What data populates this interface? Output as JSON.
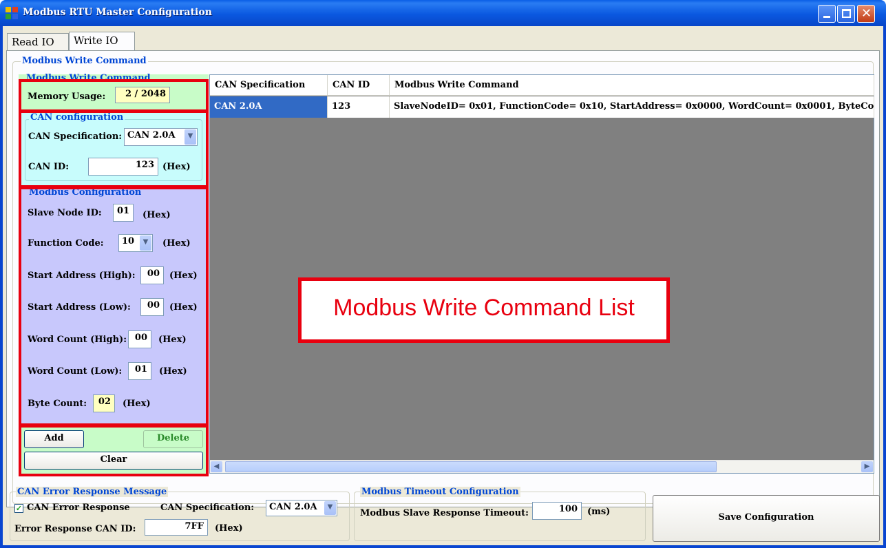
{
  "window": {
    "title": "Modbus RTU Master Configuration"
  },
  "tabs": [
    {
      "label": "Read IO"
    },
    {
      "label": "Write IO"
    }
  ],
  "write_group": {
    "title": "Modbus Write Command"
  },
  "inner_group": {
    "title": "Modbus Write Command"
  },
  "memory": {
    "label": "Memory Usage:",
    "value": "2 / 2048"
  },
  "can_config": {
    "title": "CAN configuration",
    "spec_label": "CAN Specification:",
    "spec_value": "CAN 2.0A",
    "id_label": "CAN ID:",
    "id_value": "123",
    "id_unit": "(Hex)"
  },
  "modbus_config": {
    "title": "Modbus Configuration",
    "slave_label": "Slave Node ID:",
    "slave_value": "01",
    "slave_unit": "(Hex)",
    "func_label": "Function Code:",
    "func_value": "10",
    "func_unit": "(Hex)",
    "start_high_label": "Start Address (High):",
    "start_high_value": "00",
    "start_high_unit": "(Hex)",
    "start_low_label": "Start Address (Low):",
    "start_low_value": "00",
    "start_low_unit": "(Hex)",
    "wc_high_label": "Word Count (High):",
    "wc_high_value": "00",
    "wc_high_unit": "(Hex)",
    "wc_low_label": "Word Count (Low):",
    "wc_low_value": "01",
    "wc_low_unit": "(Hex)",
    "byte_label": "Byte Count:",
    "byte_value": "02",
    "byte_unit": "(Hex)"
  },
  "buttons": {
    "add": "Add",
    "delete": "Delete",
    "clear": "Clear",
    "save": "Save Configuration"
  },
  "table": {
    "headers": [
      "CAN Specification",
      "CAN ID",
      "Modbus Write Command"
    ],
    "rows": [
      [
        "CAN 2.0A",
        "123",
        "SlaveNodeID= 0x01, FunctionCode= 0x10, StartAddress= 0x0000, WordCount= 0x0001, ByteCo"
      ]
    ]
  },
  "annotation": {
    "label": "Modbus Write Command List"
  },
  "error_group": {
    "title": "CAN Error Response Message",
    "checkbox_label": "CAN Error Response",
    "checked": true,
    "spec_label": "CAN Specification:",
    "spec_value": "CAN 2.0A",
    "id_label": "Error Response CAN ID:",
    "id_value": "7FF",
    "id_unit": "(Hex)"
  },
  "timeout_group": {
    "title": "Modbus Timeout Configuration",
    "label": "Modbus Slave Response Timeout:",
    "value": "100",
    "unit": "(ms)"
  },
  "colors": {
    "memory_bg": "#c8fcc8",
    "can_bg": "#c8fcfc",
    "modbus_bg": "#c8c8fc",
    "highlight": "#ffffc0",
    "selected_row": "#316ac5",
    "annotation": "#e8000f"
  }
}
